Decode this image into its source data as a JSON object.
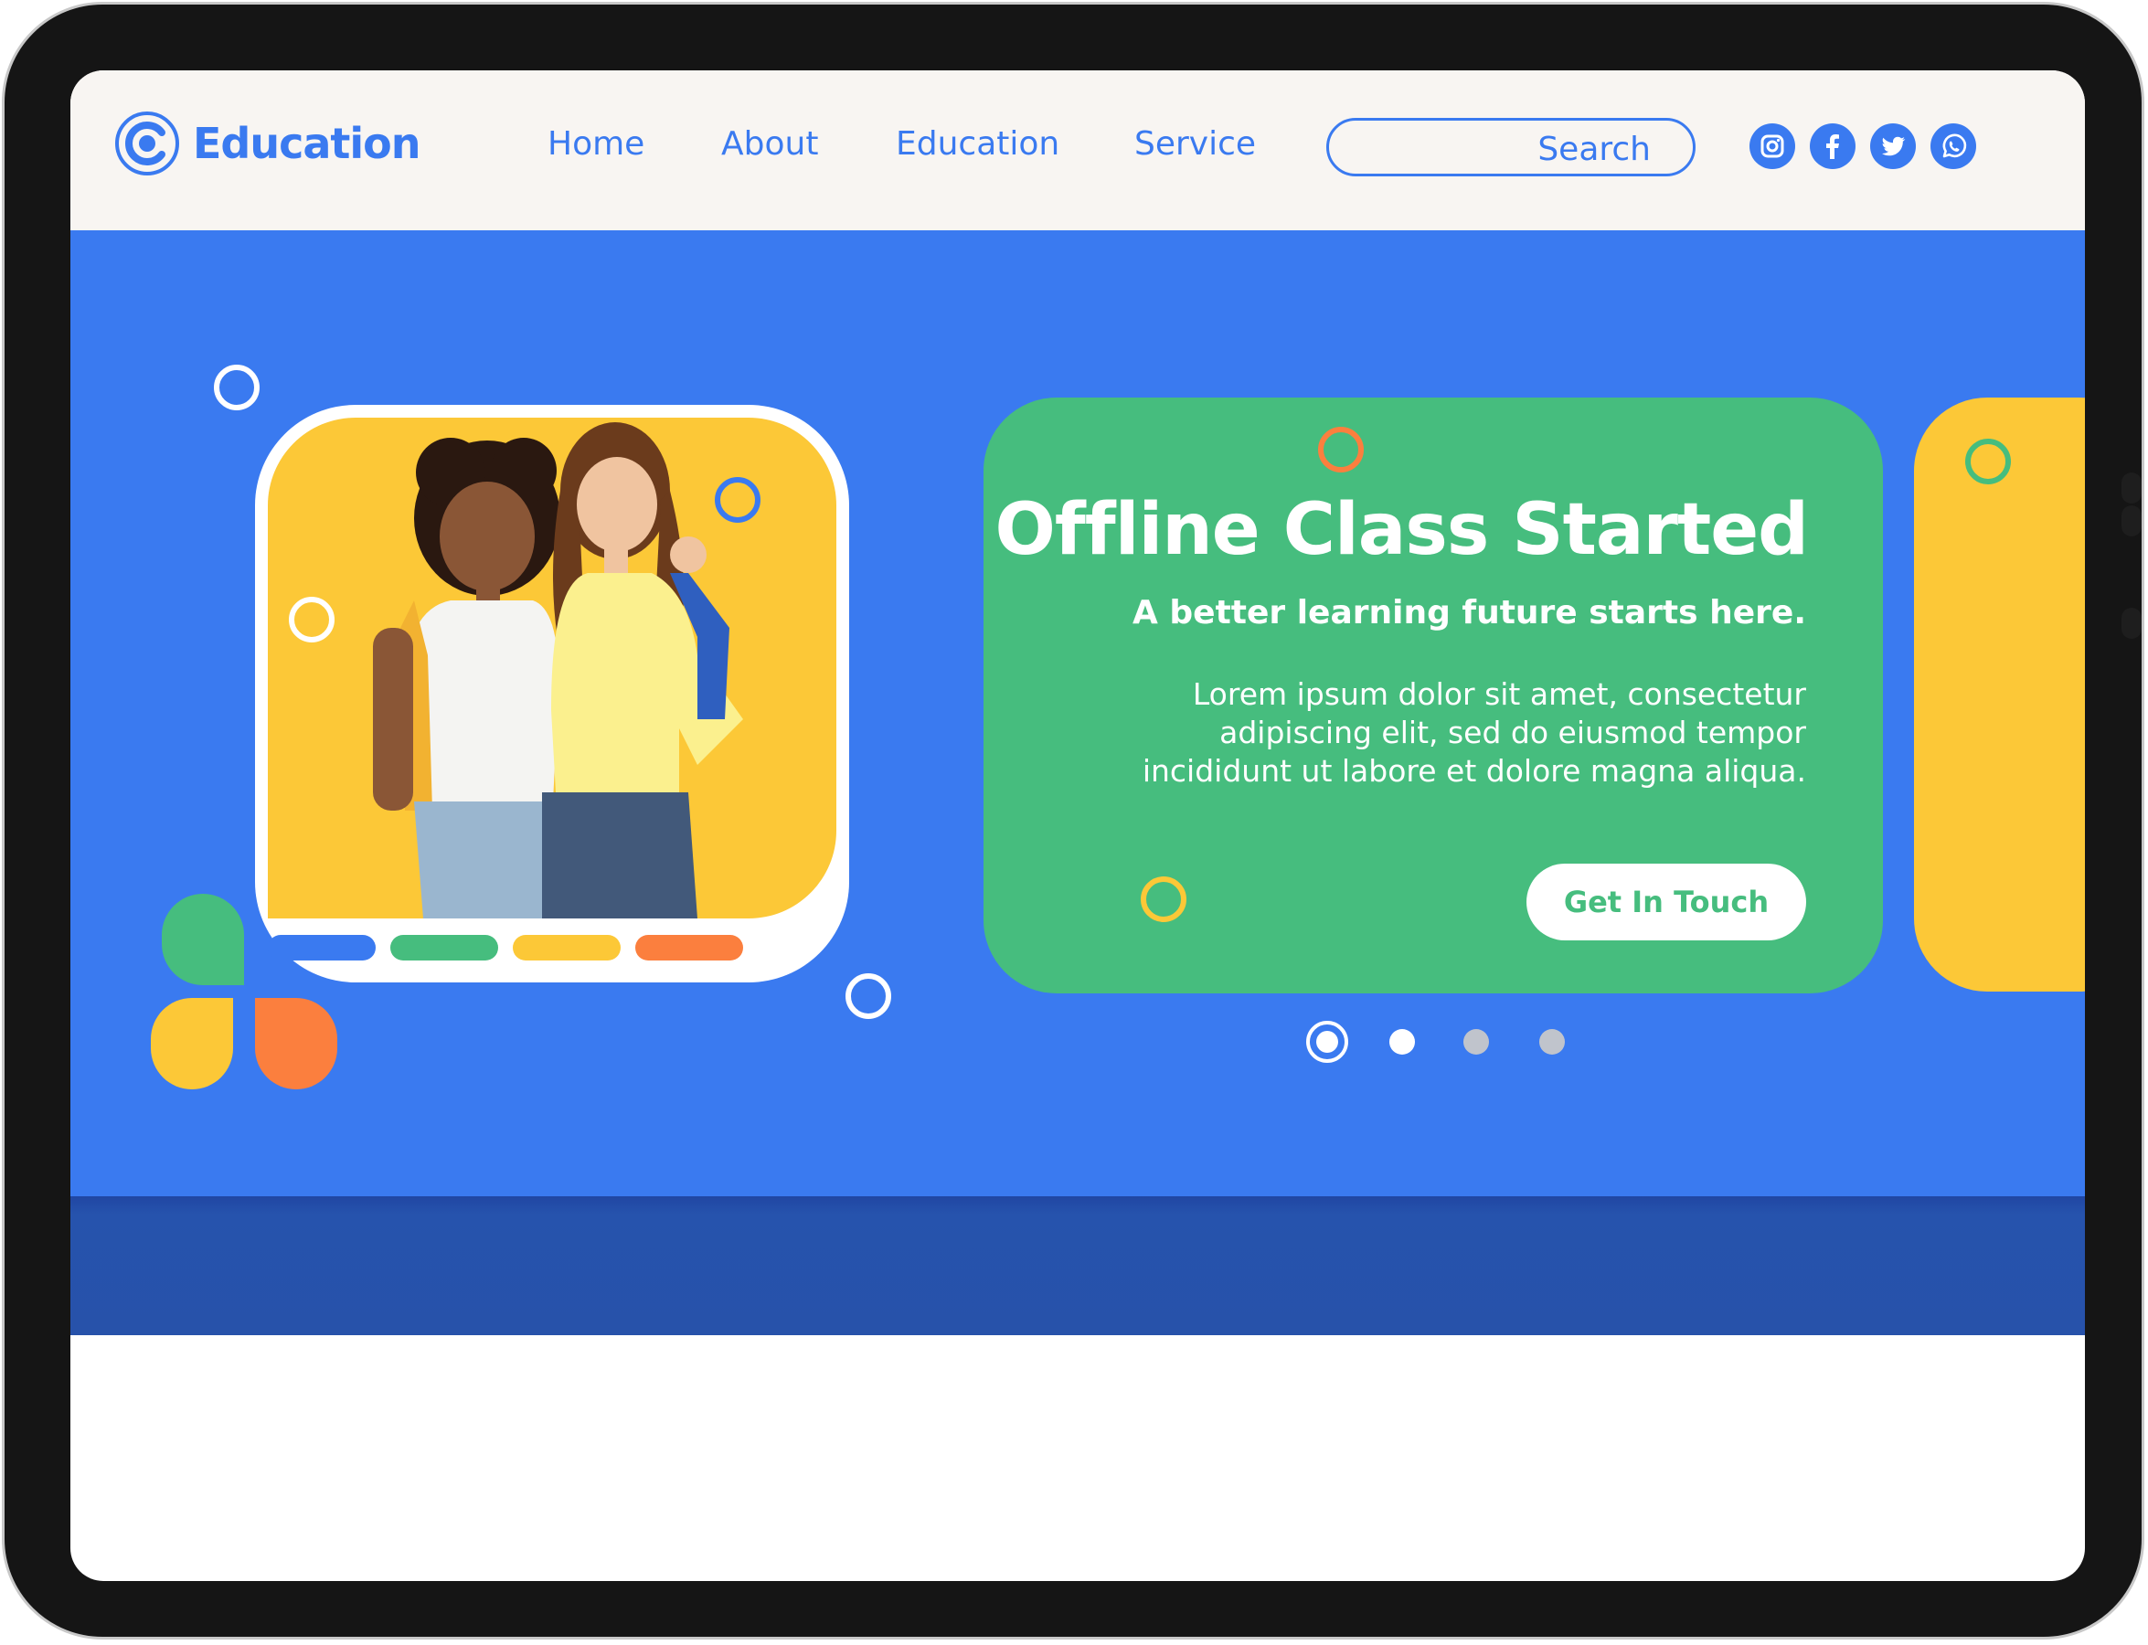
{
  "brand": {
    "name": "Education"
  },
  "nav": {
    "items": [
      {
        "label": "Home"
      },
      {
        "label": "About"
      },
      {
        "label": "Education"
      },
      {
        "label": "Service"
      }
    ]
  },
  "search": {
    "placeholder": "Search"
  },
  "social": [
    {
      "icon": "instagram-icon"
    },
    {
      "icon": "facebook-icon"
    },
    {
      "icon": "twitter-icon"
    },
    {
      "icon": "whatsapp-icon"
    }
  ],
  "hero": {
    "title": "Offline Class Started",
    "subtitle": "A better learning future starts here.",
    "body": "Lorem ipsum dolor sit amet, consectetur adipiscing elit, sed do eiusmod tempor incididunt ut labore et dolore magna aliqua.",
    "cta_label": "Get In Touch",
    "image": "two-smiling-schoolgirls-with-backpacks-photo"
  },
  "carousel": {
    "slide_count": 4,
    "active_slide": 1
  },
  "colors": {
    "primary_blue": "#3a7af0",
    "green": "#46bd7e",
    "yellow": "#fcc837",
    "orange": "#fb7f3e",
    "header_bg": "#f8f5f2",
    "hero_shadow": "#2752aa"
  }
}
